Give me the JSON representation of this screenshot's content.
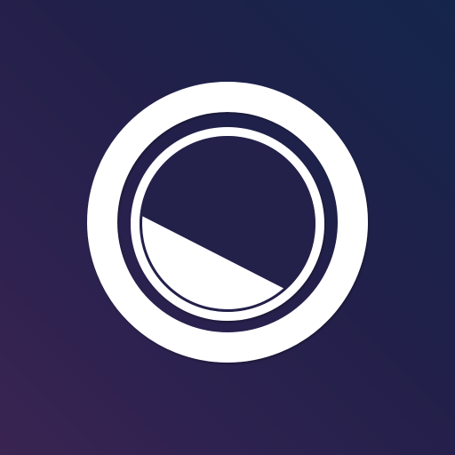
{
  "icon": {
    "name": "dial-logo-icon",
    "colors": {
      "background_top_right": "#14254b",
      "background_bottom_left": "#3a2451",
      "foreground": "#ffffff",
      "inner_face": "#23204a"
    }
  }
}
